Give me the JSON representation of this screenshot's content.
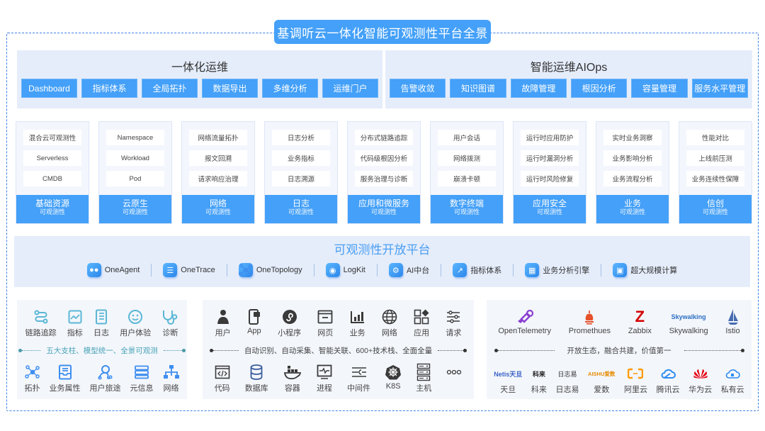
{
  "title": "基调听云一体化智能可观测性平台全景",
  "colors": {
    "accent": "#44a0f8",
    "section_bg": "#e5edfb",
    "panel_bg": "#f3f6fb",
    "border_dash": "#3d7fe6",
    "teal": "#4aa4b8"
  },
  "integrated_ops": {
    "title": "一体化运维",
    "buttons": [
      "Dashboard",
      "指标体系",
      "全局拓扑",
      "数据导出",
      "多维分析",
      "运维门户"
    ]
  },
  "aiops": {
    "title": "智能运维AIOps",
    "buttons": [
      "告警收敛",
      "知识图谱",
      "故障管理",
      "根因分析",
      "容量管理",
      "服务水平管理"
    ]
  },
  "pillars": [
    {
      "name": "基础资源",
      "sub": "可观测性",
      "items": [
        "混合云可观测性",
        "Serverless",
        "CMDB"
      ]
    },
    {
      "name": "云原生",
      "sub": "可观测性",
      "items": [
        "Namespace",
        "Workload",
        "Pod"
      ]
    },
    {
      "name": "网络",
      "sub": "可观测性",
      "items": [
        "网络流量拓扑",
        "报文回溯",
        "请求响应治理"
      ]
    },
    {
      "name": "日志",
      "sub": "可观测性",
      "items": [
        "日志分析",
        "业务指标",
        "日志溯源"
      ]
    },
    {
      "name": "应用和微服务",
      "sub": "可观测性",
      "items": [
        "分布式链路追踪",
        "代码级根因分析",
        "服务治理与诊断"
      ]
    },
    {
      "name": "数字终端",
      "sub": "可观测性",
      "items": [
        "用户会话",
        "网络拨测",
        "崩溃卡顿"
      ]
    },
    {
      "name": "应用安全",
      "sub": "可观测性",
      "items": [
        "运行时应用防护",
        "运行时漏洞分析",
        "运行时风险修复"
      ]
    },
    {
      "name": "业务",
      "sub": "可观测性",
      "items": [
        "实时业务洞察",
        "业务影响分析",
        "业务流程分析"
      ]
    },
    {
      "name": "信创",
      "sub": "可观测性",
      "items": [
        "性能对比",
        "上线前压测",
        "业务连续性保障"
      ]
    }
  ],
  "platform": {
    "title": "可观测性开放平台",
    "items": [
      {
        "label": "OneAgent",
        "icon": "users-icon"
      },
      {
        "label": "OneTrace",
        "icon": "list-icon"
      },
      {
        "label": "OneTopology",
        "icon": "topology-icon"
      },
      {
        "label": "LogKit",
        "icon": "log-icon"
      },
      {
        "label": "AI中台",
        "icon": "ai-head-icon"
      },
      {
        "label": "指标体系",
        "icon": "metrics-icon"
      },
      {
        "label": "业务分析引擎",
        "icon": "engine-icon"
      },
      {
        "label": "超大规模计算",
        "icon": "chip-icon"
      }
    ]
  },
  "pillars_panel": {
    "row1": [
      {
        "label": "链路追踪",
        "icon": "trace-icon"
      },
      {
        "label": "指标",
        "icon": "chart-icon"
      },
      {
        "label": "日志",
        "icon": "notebook-icon"
      },
      {
        "label": "用户体验",
        "icon": "smile-icon"
      },
      {
        "label": "诊断",
        "icon": "stethoscope-icon"
      }
    ],
    "tagline": "五大支柱、模型统一、全景可观测",
    "row2": [
      {
        "label": "拓扑",
        "icon": "topology-icon"
      },
      {
        "label": "业务属性",
        "icon": "inbox-icon"
      },
      {
        "label": "用户旅途",
        "icon": "journey-icon"
      },
      {
        "label": "元信息",
        "icon": "stack-icon"
      },
      {
        "label": "网络",
        "icon": "network-icon"
      }
    ]
  },
  "collect_panel": {
    "row1": [
      {
        "label": "用户",
        "icon": "user-icon"
      },
      {
        "label": "App",
        "icon": "mobile-icon"
      },
      {
        "label": "小程序",
        "icon": "miniprogram-icon"
      },
      {
        "label": "网页",
        "icon": "browser-icon"
      },
      {
        "label": "业务",
        "icon": "bar-chart-icon"
      },
      {
        "label": "网络",
        "icon": "globe-icon"
      },
      {
        "label": "应用",
        "icon": "apps-icon"
      },
      {
        "label": "请求",
        "icon": "sliders-icon"
      }
    ],
    "tagline": "自动识别、自动采集、智能关联、600+技术栈、全面全量",
    "row2": [
      {
        "label": "代码",
        "icon": "code-icon"
      },
      {
        "label": "数据库",
        "icon": "database-icon"
      },
      {
        "label": "容器",
        "icon": "docker-icon"
      },
      {
        "label": "进程",
        "icon": "monitor-icon"
      },
      {
        "label": "中间件",
        "icon": "middleware-icon"
      },
      {
        "label": "K8S",
        "icon": "k8s-icon"
      },
      {
        "label": "主机",
        "icon": "server-icon"
      },
      {
        "label": "",
        "icon": "more-icon"
      }
    ]
  },
  "ecosystem_panel": {
    "row1": [
      {
        "label": "OpenTelemetry",
        "icon": "opentelemetry-icon"
      },
      {
        "label": "Promethues",
        "icon": "prometheus-icon"
      },
      {
        "label": "Zabbix",
        "icon": "zabbix-icon"
      },
      {
        "label": "Skywalking",
        "icon": "skywalking-icon",
        "logo_text": "Skywalking"
      },
      {
        "label": "Istio",
        "icon": "istio-icon"
      }
    ],
    "tagline": "开放生态，融合共建，价值第一",
    "row2": [
      {
        "label": "天旦",
        "icon": "netis-logo",
        "logo_text": "Netis天旦"
      },
      {
        "label": "科来",
        "icon": "colasoft-logo",
        "logo_text": "科来"
      },
      {
        "label": "日志易",
        "icon": "rizhiyi-logo",
        "logo_text": "日志易"
      },
      {
        "label": "爱数",
        "icon": "aishu-logo",
        "logo_text": "AISHU爱数"
      },
      {
        "label": "阿里云",
        "icon": "aliyun-icon"
      },
      {
        "label": "腾讯云",
        "icon": "tencent-cloud-icon"
      },
      {
        "label": "华为云",
        "icon": "huawei-icon"
      },
      {
        "label": "私有云",
        "icon": "private-cloud-icon"
      }
    ]
  }
}
